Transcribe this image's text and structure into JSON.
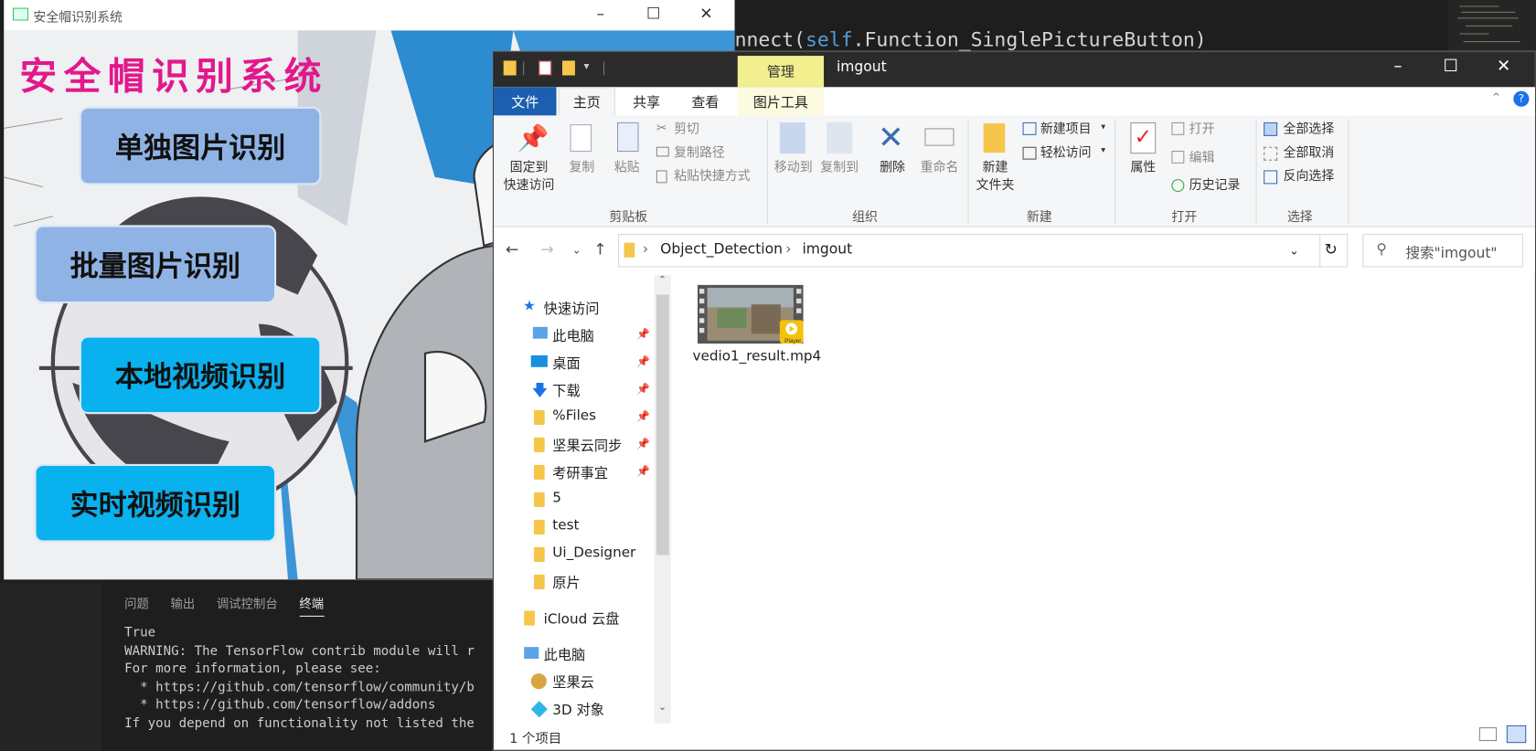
{
  "vscode": {
    "code_line_plain": "onnect(",
    "code_line_kw": "self",
    "code_line_rest": ".Function_SinglePictureButton)",
    "panel_tabs": [
      "问题",
      "输出",
      "调试控制台",
      "终端"
    ],
    "terminal_lines": [
      "True",
      "",
      "WARNING: The TensorFlow contrib module will r",
      "For more information, please see:",
      "  * https://github.com/tensorflow/community/b",
      "  * https://github.com/tensorflow/addons",
      "If you depend on functionality not listed the"
    ]
  },
  "app": {
    "window_title": "安全帽识别系统",
    "main_title": "安全帽识别系统",
    "buttons": {
      "single": "单独图片识别",
      "batch": "批量图片识别",
      "local_video": "本地视频识别",
      "realtime_video": "实时视频识别"
    },
    "colors": {
      "title": "#e2188c",
      "light_button": "#8fb3e4",
      "cyan_button": "#09b1ee"
    }
  },
  "explorer": {
    "window_title": "imgout",
    "manage_tab": "管理",
    "tabs": {
      "file": "文件",
      "home": "主页",
      "share": "共享",
      "view": "查看",
      "picture_tools": "图片工具"
    },
    "ribbon": {
      "pin_quick_access": "固定到\n快速访问",
      "copy": "复制",
      "paste": "粘贴",
      "cut": "剪切",
      "copy_path": "复制路径",
      "paste_shortcut": "粘贴快捷方式",
      "clipboard_group": "剪贴板",
      "move_to": "移动到",
      "copy_to": "复制到",
      "delete": "删除",
      "rename": "重命名",
      "organize_group": "组织",
      "new_item": "新建项目",
      "easy_access": "轻松访问",
      "new_folder": "新建\n文件夹",
      "new_group": "新建",
      "properties": "属性",
      "open": "打开",
      "edit": "编辑",
      "history": "历史记录",
      "open_group": "打开",
      "select_all": "全部选择",
      "select_none": "全部取消",
      "invert_selection": "反向选择",
      "select_group": "选择"
    },
    "breadcrumb": [
      "Object_Detection",
      "imgout"
    ],
    "search_placeholder": "搜索\"imgout\"",
    "nav": {
      "quick_access": "快速访问",
      "this_pc_pinned": "此电脑",
      "desktop": "桌面",
      "downloads": "下载",
      "files": "%Files",
      "jianguo_sync": "坚果云同步",
      "exam_matters": "考研事宜",
      "folder_5": "5",
      "test": "test",
      "ui_designer": "Ui_Designer",
      "originals": "原片",
      "icloud": "iCloud 云盘",
      "this_pc": "此电脑",
      "jianguoyun": "坚果云",
      "objects_3d": "3D 对象"
    },
    "file": {
      "name": "vedio1_result.mp4",
      "badge": "Player"
    },
    "status": "1 个项目"
  }
}
